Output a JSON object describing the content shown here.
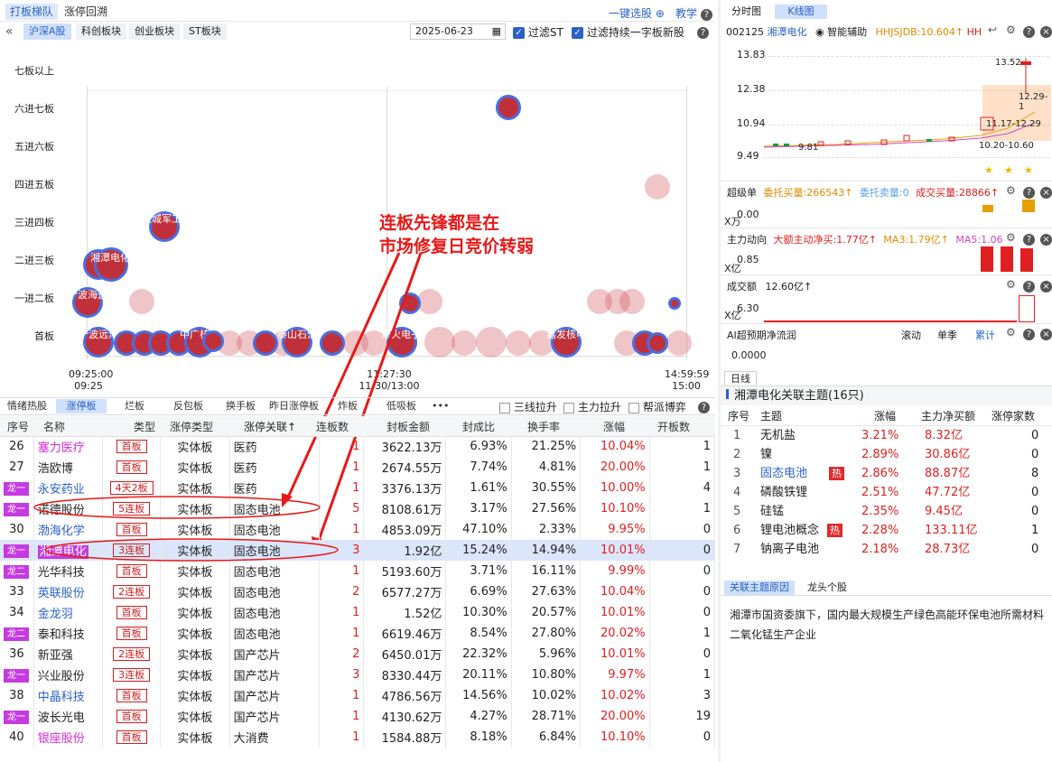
{
  "top_tabs": [
    "打板梯队",
    "涨停回溯"
  ],
  "top_right": {
    "one_key": "一键选股",
    "teach": "教学"
  },
  "market_tabs": [
    "沪深A股",
    "科创板块",
    "创业板块",
    "ST板块"
  ],
  "date": "2025-06-23",
  "filters": {
    "st": "过滤ST",
    "one_word": "过滤持续一字板新股"
  },
  "ladder_levels": [
    "七板以上",
    "六进七板",
    "五进六板",
    "四进五板",
    "三进四板",
    "二进三板",
    "一进二板",
    "首板"
  ],
  "time_labels": {
    "t1": "09:25:00",
    "t1b": "09:25",
    "t2": "11:27:30",
    "t2b": "11:30/13:00",
    "t3": "14:59:59",
    "t3b": "15:00"
  },
  "bubble_labels": {
    "changcheng": "长城军工",
    "xiangtan": "湘潭电化",
    "ningbo_yy": "宁波海运",
    "ningbo_ys": "宁波远洋",
    "zhongguang": "中广核技",
    "taishan": "泰山石油",
    "shuanghuo": "泽火电子",
    "jiafa": "嘉发核电"
  },
  "annotation": "连板先锋都是在\n市场修复日竞价转弱",
  "sub_tabs": [
    "情绪热股",
    "涨停板",
    "烂板",
    "反包板",
    "换手板",
    "昨日涨停板",
    "炸板",
    "低吸板"
  ],
  "sub_more": "•••",
  "sub_filters": [
    "三线拉升",
    "主力拉升",
    "帮派博弈"
  ],
  "table_headers": [
    "序号",
    "名称",
    "类型",
    "涨停类型",
    "涨停关联↑",
    "连板数",
    "封板金额",
    "封成比",
    "换手率",
    "涨幅",
    "开板数"
  ],
  "rows": [
    {
      "no": "26",
      "name": "塞力医疗",
      "tag": "首板",
      "ztype": "实体板",
      "rel": "医药",
      "lb": "1",
      "amt": "3622.13万",
      "ratio": "6.93%",
      "turn": "21.25%",
      "pct": "10.04%",
      "open": "1",
      "nc": "#d62ad6"
    },
    {
      "no": "27",
      "name": "浩欧博",
      "tag": "首板",
      "ztype": "实体板",
      "rel": "医药",
      "lb": "1",
      "amt": "2674.55万",
      "ratio": "7.74%",
      "turn": "4.81%",
      "pct": "20.00%",
      "open": "1",
      "nc": "#222"
    },
    {
      "no": "龙一",
      "name": "永安药业",
      "tag": "4天2板",
      "ztype": "实体板",
      "rel": "医药",
      "lb": "1",
      "amt": "3376.13万",
      "ratio": "1.61%",
      "turn": "30.55%",
      "pct": "10.00%",
      "open": "4",
      "nc": "#2a62c9"
    },
    {
      "no": "龙一",
      "name": "诺德股份",
      "tag": "5连板",
      "ztype": "实体板",
      "rel": "固态电池",
      "lb": "5",
      "amt": "8108.61万",
      "ratio": "3.17%",
      "turn": "27.56%",
      "pct": "10.10%",
      "open": "1",
      "nc": "#222"
    },
    {
      "no": "30",
      "name": "渤海化学",
      "tag": "首板",
      "ztype": "实体板",
      "rel": "固态电池",
      "lb": "1",
      "amt": "4853.09万",
      "ratio": "47.10%",
      "turn": "2.33%",
      "pct": "9.95%",
      "open": "0",
      "nc": "#2a62c9"
    },
    {
      "no": "龙一",
      "name": "湘潭电化",
      "tag": "3连板",
      "ztype": "实体板",
      "rel": "固态电池",
      "lb": "3",
      "amt": "1.92亿",
      "ratio": "15.24%",
      "turn": "14.94%",
      "pct": "10.01%",
      "open": "0",
      "nc": "#fff"
    },
    {
      "no": "龙二",
      "name": "光华科技",
      "tag": "首板",
      "ztype": "实体板",
      "rel": "固态电池",
      "lb": "1",
      "amt": "5193.60万",
      "ratio": "3.71%",
      "turn": "16.11%",
      "pct": "9.99%",
      "open": "0",
      "nc": "#222"
    },
    {
      "no": "33",
      "name": "英联股份",
      "tag": "2连板",
      "ztype": "实体板",
      "rel": "固态电池",
      "lb": "2",
      "amt": "6577.27万",
      "ratio": "6.69%",
      "turn": "27.63%",
      "pct": "10.04%",
      "open": "0",
      "nc": "#2a62c9"
    },
    {
      "no": "34",
      "name": "金龙羽",
      "tag": "首板",
      "ztype": "实体板",
      "rel": "固态电池",
      "lb": "1",
      "amt": "1.52亿",
      "ratio": "10.30%",
      "turn": "20.57%",
      "pct": "10.01%",
      "open": "0",
      "nc": "#2a62c9"
    },
    {
      "no": "龙二",
      "name": "泰和科技",
      "tag": "首板",
      "ztype": "实体板",
      "rel": "固态电池",
      "lb": "1",
      "amt": "6619.46万",
      "ratio": "8.54%",
      "turn": "27.80%",
      "pct": "20.02%",
      "open": "1",
      "nc": "#222"
    },
    {
      "no": "36",
      "name": "新亚强",
      "tag": "2连板",
      "ztype": "实体板",
      "rel": "国产芯片",
      "lb": "2",
      "amt": "6450.01万",
      "ratio": "22.32%",
      "turn": "5.96%",
      "pct": "10.01%",
      "open": "0",
      "nc": "#222"
    },
    {
      "no": "龙一",
      "name": "兴业股份",
      "tag": "3连板",
      "ztype": "实体板",
      "rel": "国产芯片",
      "lb": "3",
      "amt": "8330.44万",
      "ratio": "20.11%",
      "turn": "10.80%",
      "pct": "9.97%",
      "open": "1",
      "nc": "#222"
    },
    {
      "no": "38",
      "name": "中晶科技",
      "tag": "首板",
      "ztype": "实体板",
      "rel": "国产芯片",
      "lb": "1",
      "amt": "4786.56万",
      "ratio": "14.56%",
      "turn": "10.02%",
      "pct": "10.02%",
      "open": "3",
      "nc": "#2a62c9"
    },
    {
      "no": "龙一",
      "name": "波长光电",
      "tag": "首板",
      "ztype": "实体板",
      "rel": "国产芯片",
      "lb": "1",
      "amt": "4130.62万",
      "ratio": "4.27%",
      "turn": "28.71%",
      "pct": "20.00%",
      "open": "19",
      "nc": "#222"
    },
    {
      "no": "40",
      "name": "银座股份",
      "tag": "首板",
      "ztype": "实体板",
      "rel": "大消费",
      "lb": "1",
      "amt": "1584.88万",
      "ratio": "8.18%",
      "turn": "6.84%",
      "pct": "10.10%",
      "open": "0",
      "nc": "#d62ad6"
    }
  ],
  "right": {
    "tabs": [
      "分时图",
      "K线图"
    ],
    "code": "002125",
    "name": "湘潭电化",
    "assist": "智能辅助",
    "hhjs": "HHJSJDB:10.604↑",
    "hh": "HH",
    "kline": {
      "y1": "13.83",
      "y2": "12.38",
      "y3": "10.94",
      "y4": "9.49",
      "p1": "13.52",
      "p2": "12.29-1",
      "p3": "11.17-12.29",
      "p4": "10.20-10.60",
      "p5": "9.81"
    },
    "super": {
      "title": "超级单",
      "buy": "委托买量:266543↑",
      "sell": "委托卖量:0",
      "deal": "成交买量:28866↑",
      "unit": "X万",
      "zero": "0.00"
    },
    "main": {
      "title": "主力动向",
      "net": "大额主动净买:1.77亿↑",
      "ma3": "MA3:1.79亿↑",
      "ma5": "MA5:1.06",
      "v": "0.85",
      "unit": "X亿"
    },
    "vol": {
      "title": "成交额",
      "val": "12.60亿↑",
      "v": "6.30",
      "unit": "X亿"
    },
    "ai": {
      "title": "AI超预期净流润",
      "tabs": [
        "滚动",
        "单季",
        "累计"
      ],
      "zero": "0.0000"
    },
    "daily": "日线",
    "theme_title": "湘潭电化关联主题(16只)",
    "theme_headers": [
      "序号",
      "主题",
      "涨幅",
      "主力净买额",
      "涨停家数"
    ],
    "themes": [
      {
        "no": "1",
        "name": "无机盐",
        "pct": "3.21%",
        "net": "8.32亿",
        "cnt": "0",
        "hot": false,
        "link": false
      },
      {
        "no": "2",
        "name": "镍",
        "pct": "2.89%",
        "net": "30.86亿",
        "cnt": "0",
        "hot": false,
        "link": false
      },
      {
        "no": "3",
        "name": "固态电池",
        "pct": "2.86%",
        "net": "88.87亿",
        "cnt": "8",
        "hot": true,
        "link": true
      },
      {
        "no": "4",
        "name": "磷酸铁锂",
        "pct": "2.51%",
        "net": "47.72亿",
        "cnt": "0",
        "hot": false,
        "link": false
      },
      {
        "no": "5",
        "name": "硅锰",
        "pct": "2.35%",
        "net": "9.45亿",
        "cnt": "0",
        "hot": false,
        "link": false
      },
      {
        "no": "6",
        "name": "锂电池概念",
        "pct": "2.28%",
        "net": "133.11亿",
        "cnt": "1",
        "hot": true,
        "link": false
      },
      {
        "no": "7",
        "name": "钠离子电池",
        "pct": "2.18%",
        "net": "28.73亿",
        "cnt": "0",
        "hot": false,
        "link": false
      }
    ],
    "hot_label": "热",
    "reason_tabs": [
      "关联主题原因",
      "龙头个股"
    ],
    "reason_text": "湘潭市国资委旗下，国内最大规模生产绿色高能环保电池所需材料二氧化锰生产企业"
  }
}
